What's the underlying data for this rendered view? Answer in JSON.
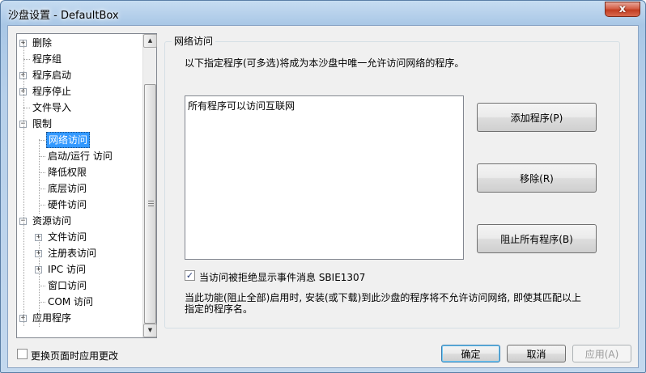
{
  "window": {
    "title": "沙盘设置 - DefaultBox",
    "close_glyph": "x"
  },
  "tree": {
    "items": [
      {
        "label": "删除",
        "expander": "+"
      },
      {
        "label": "程序组",
        "expander": ""
      },
      {
        "label": "程序启动",
        "expander": "+"
      },
      {
        "label": "程序停止",
        "expander": "+"
      },
      {
        "label": "文件导入",
        "expander": ""
      },
      {
        "label": "限制",
        "expander": "−"
      },
      {
        "label": "网络访问",
        "expander": "",
        "selected": true
      },
      {
        "label": "启动/运行 访问",
        "expander": ""
      },
      {
        "label": "降低权限",
        "expander": ""
      },
      {
        "label": "底层访问",
        "expander": ""
      },
      {
        "label": "硬件访问",
        "expander": ""
      },
      {
        "label": "资源访问",
        "expander": "−"
      },
      {
        "label": "文件访问",
        "expander": "+"
      },
      {
        "label": "注册表访问",
        "expander": "+"
      },
      {
        "label": "IPC 访问",
        "expander": "+"
      },
      {
        "label": "窗口访问",
        "expander": ""
      },
      {
        "label": "COM 访问",
        "expander": ""
      },
      {
        "label": "应用程序",
        "expander": "+"
      }
    ]
  },
  "scroll": {
    "up_glyph": "▲",
    "down_glyph": "▼"
  },
  "panel": {
    "group_title": "网络访问",
    "description": "以下指定程序(可多选)将成为本沙盘中唯一允许访问网络的程序。",
    "list_items": [
      "所有程序可以访问互联网"
    ],
    "add_button": "添加程序(P)",
    "remove_button": "移除(R)",
    "block_all_button": "阻止所有程序(B)",
    "show_event_checkbox": {
      "label": "当访问被拒绝显示事件消息 SBIE1307",
      "checked": true,
      "mark": "✓"
    },
    "note": "当此功能(阻止全部)启用时, 安装(或下载)到此沙盘的程序将不允许访问网络, 即使其匹配以上指定的程序名。"
  },
  "footer": {
    "apply_on_change_checkbox": {
      "label": "更换页面时应用更改",
      "checked": false
    },
    "ok_button": "确定",
    "cancel_button": "取消",
    "apply_button": "应用(A)"
  }
}
